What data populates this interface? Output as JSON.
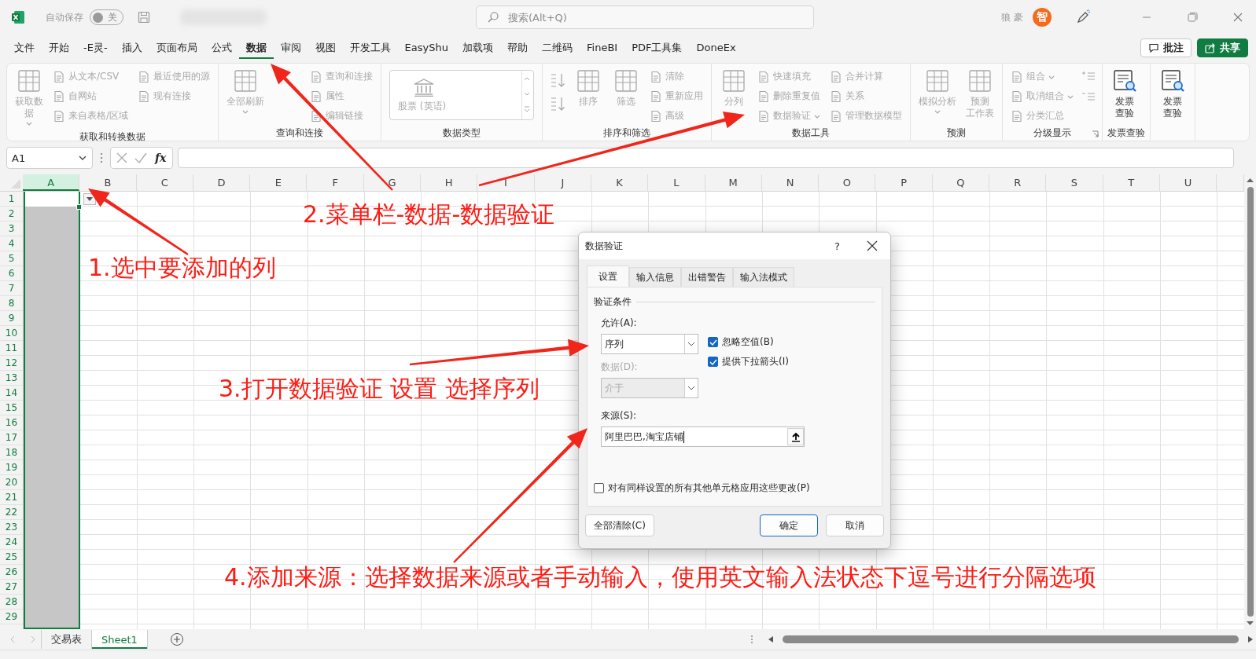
{
  "titlebar": {
    "autosave_label": "自动保存",
    "autosave_on": false,
    "autosave_state": "关",
    "search_placeholder": "搜索(Alt+Q)",
    "user_name": "狼 豪",
    "avatar_text": "智"
  },
  "menu": {
    "tabs": [
      {
        "label": "文件",
        "selected": false
      },
      {
        "label": "开始",
        "selected": false
      },
      {
        "label": "-E灵-",
        "selected": false
      },
      {
        "label": "插入",
        "selected": false
      },
      {
        "label": "页面布局",
        "selected": false
      },
      {
        "label": "公式",
        "selected": false
      },
      {
        "label": "数据",
        "selected": true
      },
      {
        "label": "审阅",
        "selected": false
      },
      {
        "label": "视图",
        "selected": false
      },
      {
        "label": "开发工具",
        "selected": false
      },
      {
        "label": "EasyShu",
        "selected": false
      },
      {
        "label": "加载项",
        "selected": false
      },
      {
        "label": "帮助",
        "selected": false
      },
      {
        "label": "二维码",
        "selected": false
      },
      {
        "label": "FineBI",
        "selected": false
      },
      {
        "label": "PDF工具集",
        "selected": false
      },
      {
        "label": "DoneEx",
        "selected": false
      }
    ],
    "buttons": [
      {
        "label": "批注",
        "kind": "outline"
      },
      {
        "label": "共享",
        "kind": "primary"
      }
    ]
  },
  "ribbon": {
    "groups": [
      {
        "label": "获取和转换数据",
        "columns": [
          {
            "kind": "large",
            "lines": [
              "获取数",
              "据"
            ],
            "dropdown": true,
            "disabled": true
          },
          {
            "kind": "stack",
            "items": [
              {
                "text": "从文本/CSV",
                "disabled": true
              },
              {
                "text": "自网站",
                "disabled": true
              },
              {
                "text": "来自表格/区域",
                "disabled": true
              }
            ]
          },
          {
            "kind": "stack",
            "items": [
              {
                "text": "最近使用的源",
                "disabled": true
              },
              {
                "text": "现有连接",
                "disabled": true
              }
            ]
          }
        ]
      },
      {
        "label": "查询和连接",
        "columns": [
          {
            "kind": "large",
            "lines": [
              "全部刷新"
            ],
            "dropdown": true,
            "disabled": true
          },
          {
            "kind": "stack",
            "items": [
              {
                "text": "查询和连接",
                "disabled": true
              },
              {
                "text": "属性",
                "disabled": true
              },
              {
                "text": "编辑链接",
                "disabled": true
              }
            ]
          }
        ]
      },
      {
        "label": "数据类型",
        "columns": [
          {
            "kind": "gallery",
            "text": "股票 (英语)",
            "disabled": true
          }
        ]
      },
      {
        "label": "排序和筛选",
        "columns": [
          {
            "kind": "sorticons",
            "disabled": true
          },
          {
            "kind": "large",
            "lines": [
              "排序"
            ],
            "disabled": true
          },
          {
            "kind": "large",
            "lines": [
              "筛选"
            ],
            "disabled": true
          },
          {
            "kind": "stack",
            "items": [
              {
                "text": "清除",
                "disabled": true
              },
              {
                "text": "重新应用",
                "disabled": true
              },
              {
                "text": "高级",
                "disabled": true
              }
            ]
          }
        ]
      },
      {
        "label": "数据工具",
        "columns": [
          {
            "kind": "large",
            "lines": [
              "分列"
            ],
            "disabled": true
          },
          {
            "kind": "stack",
            "items": [
              {
                "text": "快速填充",
                "disabled": true
              },
              {
                "text": "删除重复值",
                "disabled": true
              },
              {
                "text": "数据验证",
                "dropdown": true,
                "disabled": true
              }
            ]
          },
          {
            "kind": "stack",
            "items": [
              {
                "text": "合并计算",
                "disabled": true
              },
              {
                "text": "关系",
                "disabled": true
              },
              {
                "text": "管理数据模型",
                "disabled": true
              }
            ]
          }
        ]
      },
      {
        "label": "预测",
        "columns": [
          {
            "kind": "large",
            "lines": [
              "模拟分析"
            ],
            "dropdown": true,
            "disabled": true
          },
          {
            "kind": "large",
            "lines": [
              "预测",
              "工作表"
            ],
            "disabled": true
          }
        ]
      },
      {
        "label": "分级显示",
        "launcher": true,
        "columns": [
          {
            "kind": "stack",
            "items": [
              {
                "text": "组合",
                "dropdown": true,
                "disabled": true
              },
              {
                "text": "取消组合",
                "dropdown": true,
                "disabled": true
              },
              {
                "text": "分类汇总",
                "disabled": true
              }
            ]
          },
          {
            "kind": "detailicons",
            "disabled": true
          }
        ]
      },
      {
        "label": "发票查验",
        "columns": [
          {
            "kind": "invoice",
            "lines": [
              "发票",
              "查验"
            ],
            "disabled": false
          }
        ]
      },
      {
        "columns": [
          {
            "kind": "invoice",
            "lines": [
              "发票",
              "查验"
            ],
            "disabled": false
          }
        ]
      }
    ]
  },
  "formula_bar": {
    "name_box": "A1",
    "fx_label": "fx"
  },
  "sheet": {
    "columns": [
      {
        "label": "A",
        "selected": true
      },
      {
        "label": "B",
        "selected": false
      },
      {
        "label": "C",
        "selected": false
      },
      {
        "label": "D",
        "selected": false
      },
      {
        "label": "E",
        "selected": false
      },
      {
        "label": "F",
        "selected": false
      },
      {
        "label": "G",
        "selected": false
      },
      {
        "label": "H",
        "selected": false
      },
      {
        "label": "I",
        "selected": false
      },
      {
        "label": "J",
        "selected": false
      },
      {
        "label": "K",
        "selected": false
      },
      {
        "label": "L",
        "selected": false
      },
      {
        "label": "M",
        "selected": false
      },
      {
        "label": "N",
        "selected": false
      },
      {
        "label": "O",
        "selected": false
      },
      {
        "label": "P",
        "selected": false
      },
      {
        "label": "Q",
        "selected": false
      },
      {
        "label": "R",
        "selected": false
      },
      {
        "label": "S",
        "selected": false
      },
      {
        "label": "T",
        "selected": false
      },
      {
        "label": "U",
        "selected": false
      }
    ],
    "rows": [
      "1",
      "2",
      "3",
      "4",
      "5",
      "6",
      "7",
      "8",
      "9",
      "10",
      "11",
      "12",
      "13",
      "14",
      "15",
      "16",
      "17",
      "18",
      "19",
      "20",
      "21",
      "22",
      "23",
      "24",
      "25",
      "26",
      "27",
      "28",
      "29"
    ]
  },
  "sheet_tabs": [
    {
      "label": "交易表",
      "selected": false
    },
    {
      "label": "Sheet1",
      "selected": true
    }
  ],
  "dialog": {
    "title": "数据验证",
    "help": "?",
    "tabs": [
      {
        "label": "设置",
        "selected": true
      },
      {
        "label": "输入信息",
        "selected": false
      },
      {
        "label": "出错警告",
        "selected": false
      },
      {
        "label": "输入法模式",
        "selected": false
      }
    ],
    "section": "验证条件",
    "allow": {
      "label": "允许(A):",
      "value": "序列"
    },
    "checks": [
      {
        "label": "忽略空值(B)",
        "checked": true
      },
      {
        "label": "提供下拉箭头(I)",
        "checked": true
      }
    ],
    "data": {
      "label": "数据(D):",
      "value": "介于",
      "disabled": true
    },
    "source": {
      "label": "来源(S):",
      "value": "阿里巴巴,淘宝店铺"
    },
    "apply_all": {
      "label": "对有同样设置的所有其他单元格应用这些更改(P)",
      "checked": false
    },
    "buttons": [
      {
        "label": "全部清除(C)",
        "kind": "left"
      },
      {
        "label": "确定",
        "kind": "default"
      },
      {
        "label": "取消",
        "kind": "normal"
      }
    ]
  },
  "annotations": [
    "1.选中要添加的列",
    "2.菜单栏-数据-数据验证",
    "3.打开数据验证 设置 选择序列",
    "4.添加来源：选择数据来源或者手动输入，使用英文输入法状态下逗号进行分隔选项"
  ]
}
